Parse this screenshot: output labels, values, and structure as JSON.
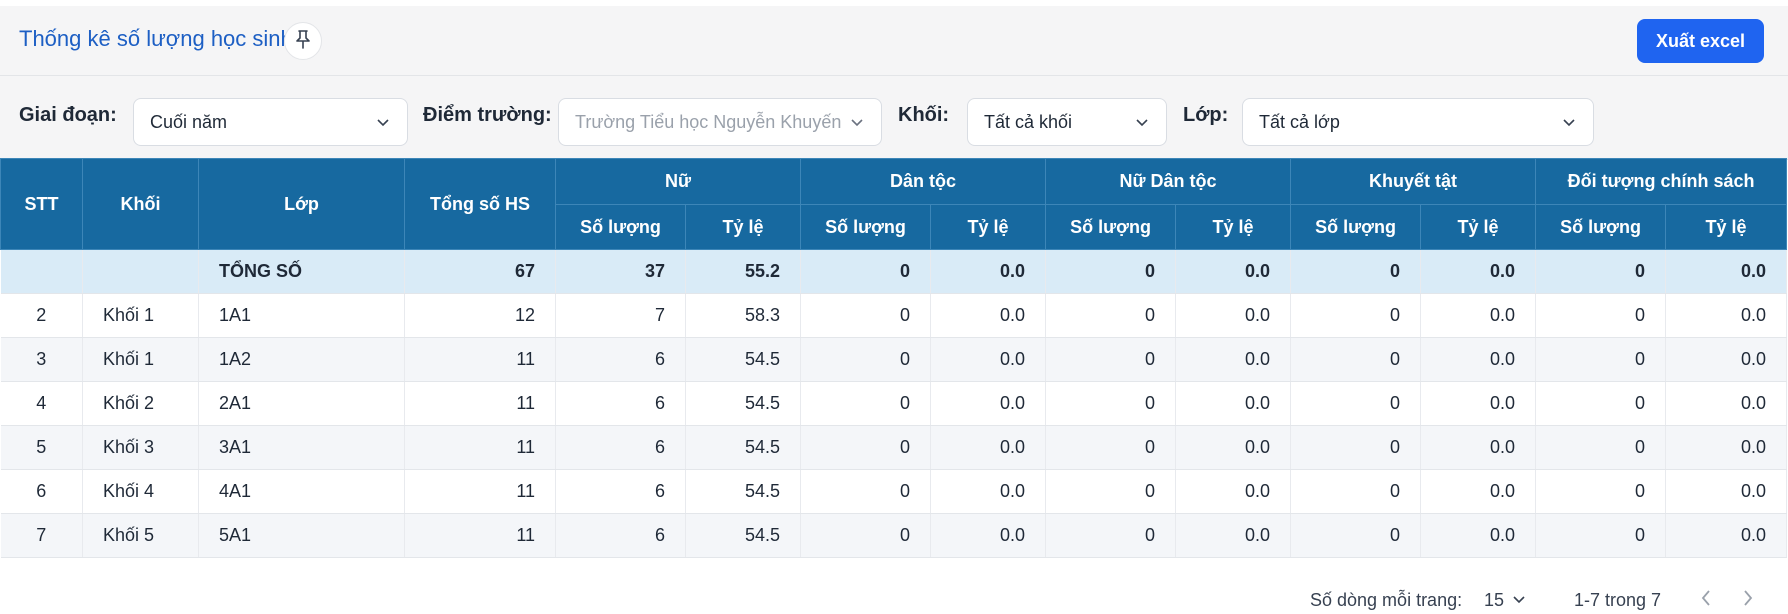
{
  "header": {
    "title": "Thống kê số lượng học sinh",
    "export_label": "Xuất excel"
  },
  "filters": {
    "stage_label": "Giai đoạn:",
    "stage_value": "Cuối năm",
    "school_label": "Điểm trường:",
    "school_value": "Trường Tiểu học Nguyễn Khuyến",
    "grade_label": "Khối:",
    "grade_value": "Tất cả khối",
    "class_label": "Lớp:",
    "class_value": "Tất cả lớp"
  },
  "table": {
    "headers": {
      "stt": "STT",
      "grade": "Khối",
      "class": "Lớp",
      "total": "Tổng số HS",
      "groups": [
        "Nữ",
        "Dân tộc",
        "Nữ Dân tộc",
        "Khuyết tật",
        "Đối tượng chính sách"
      ],
      "count": "Số lượng",
      "ratio": "Tỷ lệ"
    },
    "total_row": {
      "label": "TỔNG SỐ",
      "total": "67",
      "values": [
        "37",
        "55.2",
        "0",
        "0.0",
        "0",
        "0.0",
        "0",
        "0.0",
        "0",
        "0.0"
      ]
    },
    "rows": [
      {
        "stt": "2",
        "grade": "Khối 1",
        "class": "1A1",
        "total": "12",
        "values": [
          "7",
          "58.3",
          "0",
          "0.0",
          "0",
          "0.0",
          "0",
          "0.0",
          "0",
          "0.0"
        ]
      },
      {
        "stt": "3",
        "grade": "Khối 1",
        "class": "1A2",
        "total": "11",
        "values": [
          "6",
          "54.5",
          "0",
          "0.0",
          "0",
          "0.0",
          "0",
          "0.0",
          "0",
          "0.0"
        ]
      },
      {
        "stt": "4",
        "grade": "Khối 2",
        "class": "2A1",
        "total": "11",
        "values": [
          "6",
          "54.5",
          "0",
          "0.0",
          "0",
          "0.0",
          "0",
          "0.0",
          "0",
          "0.0"
        ]
      },
      {
        "stt": "5",
        "grade": "Khối 3",
        "class": "3A1",
        "total": "11",
        "values": [
          "6",
          "54.5",
          "0",
          "0.0",
          "0",
          "0.0",
          "0",
          "0.0",
          "0",
          "0.0"
        ]
      },
      {
        "stt": "6",
        "grade": "Khối 4",
        "class": "4A1",
        "total": "11",
        "values": [
          "6",
          "54.5",
          "0",
          "0.0",
          "0",
          "0.0",
          "0",
          "0.0",
          "0",
          "0.0"
        ]
      },
      {
        "stt": "7",
        "grade": "Khối 5",
        "class": "5A1",
        "total": "11",
        "values": [
          "6",
          "54.5",
          "0",
          "0.0",
          "0",
          "0.0",
          "0",
          "0.0",
          "0",
          "0.0"
        ]
      }
    ]
  },
  "pagination": {
    "rows_per_page_label": "Số dòng mỗi trang:",
    "rows_per_page": "15",
    "range": "1-7 trong 7"
  },
  "icons": {
    "pin": "pin-icon",
    "chevron": "chevron-down-icon",
    "prev": "chevron-left-icon",
    "next": "chevron-right-icon"
  },
  "colors": {
    "header_bg": "#1769a0",
    "accent": "#1f64f0",
    "title": "#1d5fc4",
    "total_row_bg": "#d9ebf7"
  }
}
